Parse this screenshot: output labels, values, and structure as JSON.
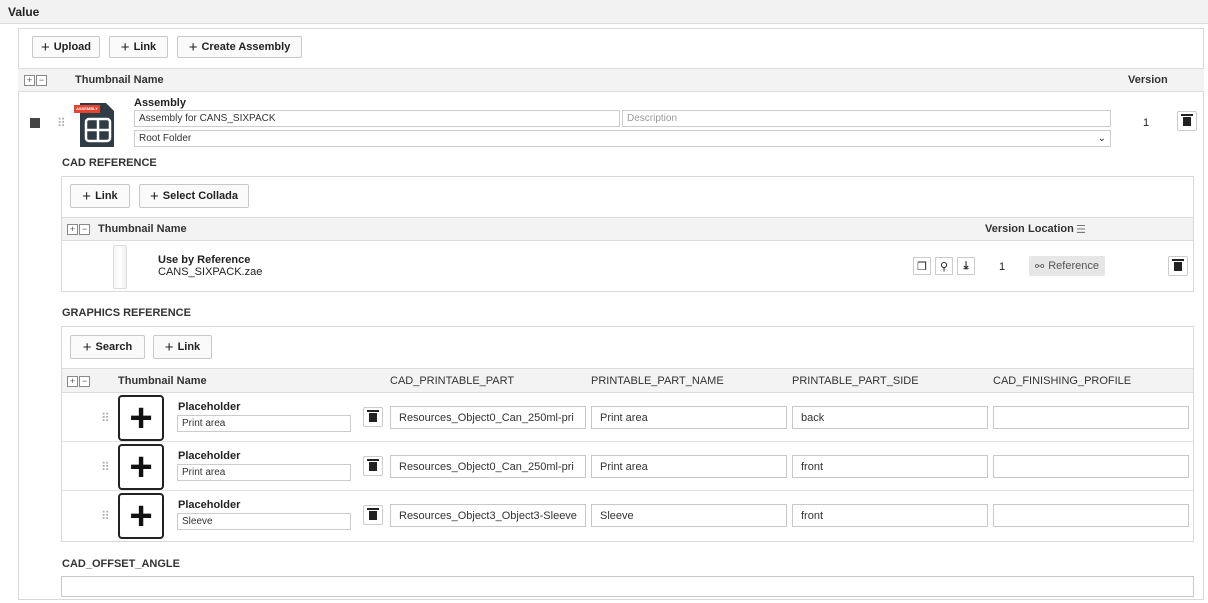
{
  "value_label": "Value",
  "toolbar": {
    "upload": "Upload",
    "link": "Link",
    "create_assembly": "Create Assembly"
  },
  "main_header": {
    "thumbnail_name": "Thumbnail Name",
    "version": "Version"
  },
  "assembly": {
    "badge": "ASSEMBLY",
    "title": "Assembly",
    "name_value": "Assembly for CANS_SIXPACK",
    "description_placeholder": "Description",
    "folder": "Root Folder",
    "version": "1"
  },
  "cad_reference": {
    "label": "CAD REFERENCE",
    "buttons": {
      "link": "Link",
      "select_collada": "Select Collada"
    },
    "header": {
      "thumbnail_name": "Thumbnail Name",
      "version": "Version",
      "location": "Location"
    },
    "row": {
      "title": "Use by Reference",
      "filename": "CANS_SIXPACK.zae",
      "version": "1",
      "reference": "Reference"
    }
  },
  "graphics_reference": {
    "label": "GRAPHICS REFERENCE",
    "buttons": {
      "search": "Search",
      "link": "Link"
    },
    "header": {
      "thumbnail_name": "Thumbnail Name",
      "cad_printable_part": "CAD_PRINTABLE_PART",
      "printable_part_name": "PRINTABLE_PART_NAME",
      "printable_part_side": "PRINTABLE_PART_SIDE",
      "cad_finishing_profile": "CAD_FINISHING_PROFILE"
    },
    "rows": [
      {
        "title": "Placeholder",
        "sub": "Print area",
        "cad_part": "Resources_Object0_Can_250ml-pri",
        "part_name": "Print area",
        "side": "back",
        "finishing": ""
      },
      {
        "title": "Placeholder",
        "sub": "Print area",
        "cad_part": "Resources_Object0_Can_250ml-pri",
        "part_name": "Print area",
        "side": "front",
        "finishing": ""
      },
      {
        "title": "Placeholder",
        "sub": "Sleeve",
        "cad_part": "Resources_Object3_Object3-Sleeve",
        "part_name": "Sleeve",
        "side": "front",
        "finishing": ""
      }
    ]
  },
  "cad_offset_angle": {
    "label": "CAD_OFFSET_ANGLE",
    "value": ""
  },
  "colors": {
    "badge_red": "#e8432e",
    "assembly_icon": "#2f3b45"
  },
  "icons": [
    "plus-icon",
    "trash-icon",
    "drag-handle-icon",
    "copy-icon",
    "search-icon",
    "download-icon",
    "link-icon",
    "chevron-down-icon",
    "filter-icon"
  ]
}
